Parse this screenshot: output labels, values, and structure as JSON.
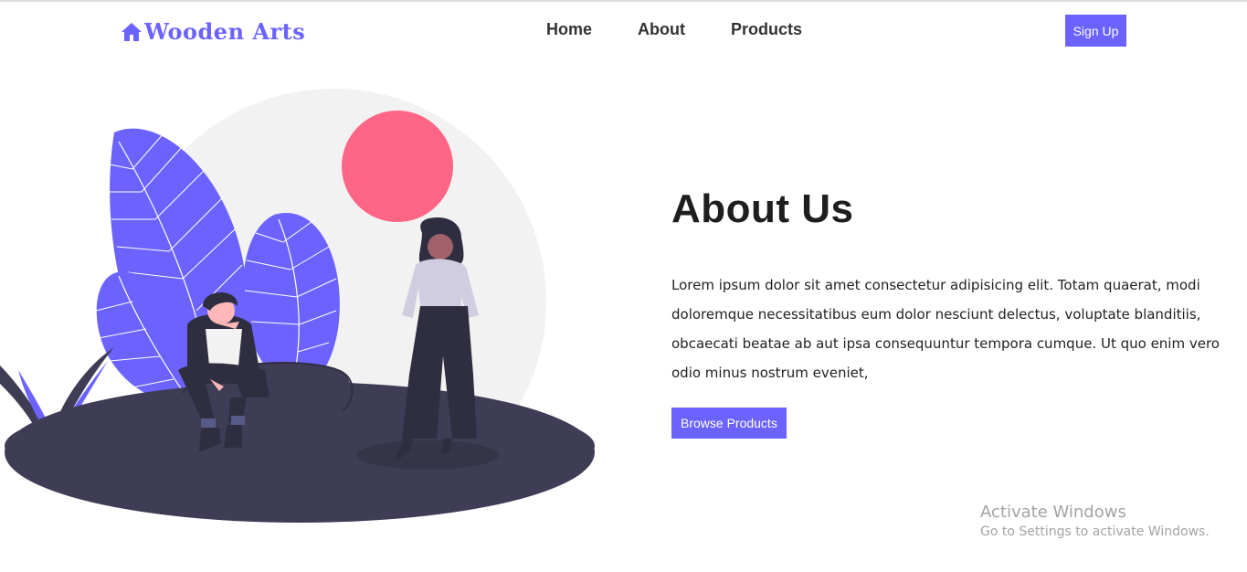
{
  "brand": {
    "name": "Wooden Arts",
    "icon": "home-icon",
    "color": "#6c63ff"
  },
  "nav": {
    "items": [
      {
        "label": "Home"
      },
      {
        "label": "About"
      },
      {
        "label": "Products"
      }
    ]
  },
  "header": {
    "signup_label": "Sign Up"
  },
  "about": {
    "title": "About Us",
    "body": "Lorem ipsum dolor sit amet consectetur adipisicing elit. Totam quaerat, modi doloremque necessitatibus eum dolor nesciunt delectus, voluptate blanditiis, obcaecati beatae ab aut ipsa consequuntur tempora cumque. Ut quo enim vero odio minus nostrum eveniet,",
    "button_label": "Browse Products"
  },
  "watermark": {
    "title": "Activate Windows",
    "subtitle": "Go to Settings to activate Windows."
  },
  "colors": {
    "accent": "#6c63ff",
    "sun": "#ff6584",
    "ground": "#3f3d56",
    "backdrop": "#f2f2f2"
  }
}
